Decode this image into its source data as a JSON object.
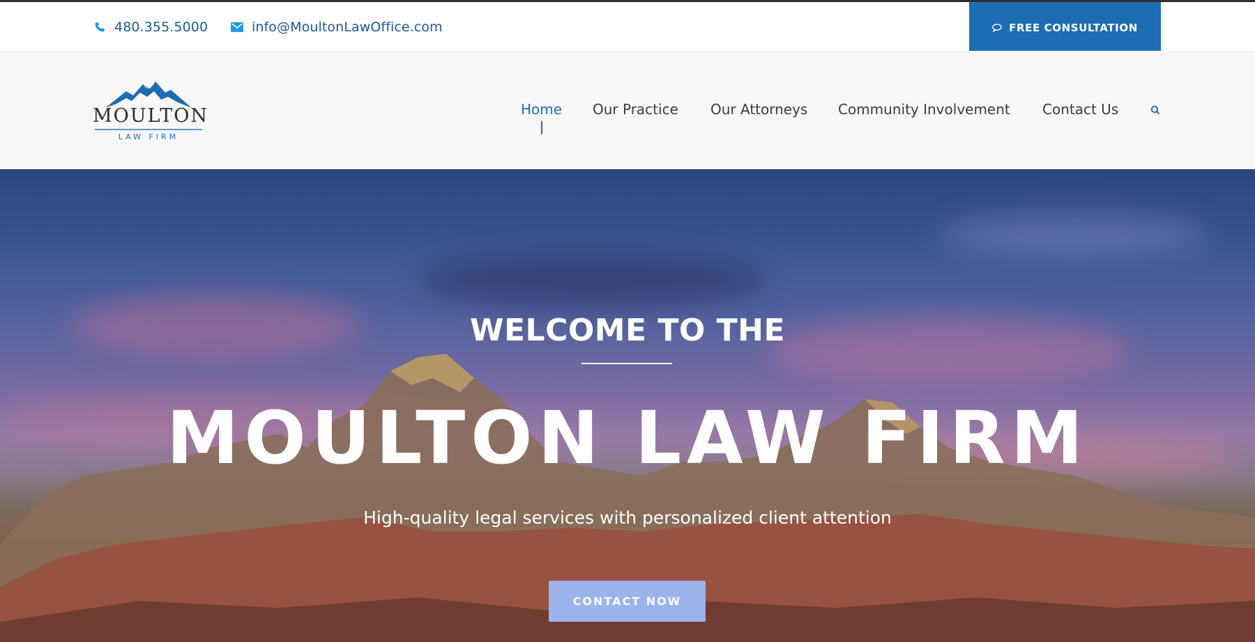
{
  "topbar": {
    "phone": "480.355.5000",
    "email": "info@MoultonLawOffice.com",
    "consult_label": "FREE CONSULTATION"
  },
  "logo": {
    "name": "MOULTON",
    "sub": "LAW FIRM"
  },
  "nav": {
    "items": [
      {
        "label": "Home",
        "active": true
      },
      {
        "label": "Our Practice"
      },
      {
        "label": "Our Attorneys"
      },
      {
        "label": "Community Involvement"
      },
      {
        "label": "Contact Us"
      }
    ]
  },
  "hero": {
    "welcome": "WELCOME TO THE",
    "title": "MOULTON LAW FIRM",
    "subtitle": "High-quality legal services with personalized client attention",
    "cta_label": "CONTACT NOW"
  },
  "colors": {
    "brand_blue": "#1d6db5",
    "cta": "#9cb3ec"
  },
  "icons": {
    "phone": "phone-icon",
    "email": "envelope-icon",
    "chat": "chat-bubble-icon",
    "search": "search-icon"
  }
}
